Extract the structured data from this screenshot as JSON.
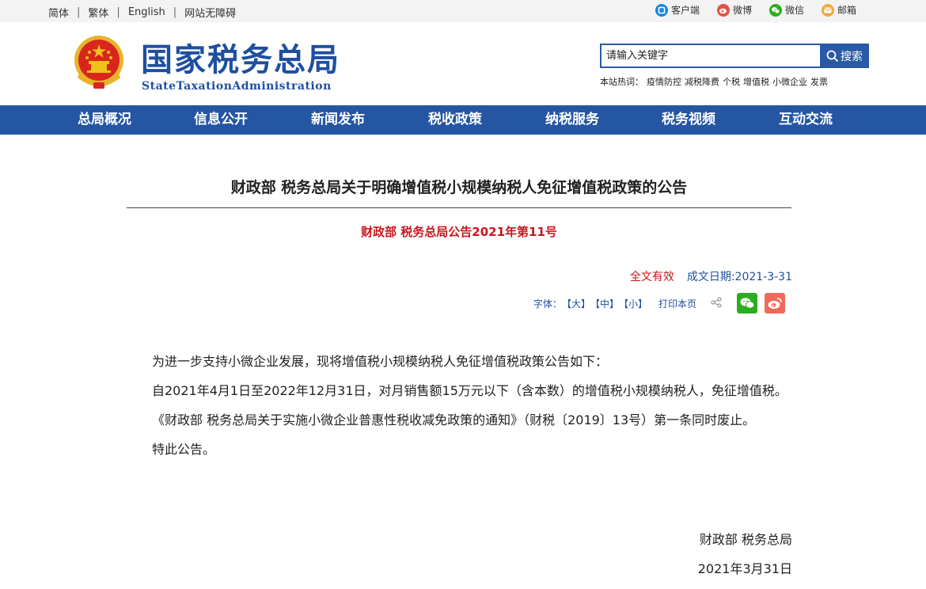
{
  "topbar": {
    "langs": [
      "简体",
      "繁体",
      "English",
      "网站无障碍"
    ],
    "socials": [
      {
        "label": "客户端",
        "icon": "client-icon",
        "color": "#1a86d8"
      },
      {
        "label": "微博",
        "icon": "weibo-icon",
        "color": "#e2533f"
      },
      {
        "label": "微信",
        "icon": "wechat-icon",
        "color": "#2aae1f"
      },
      {
        "label": "邮箱",
        "icon": "mail-icon",
        "color": "#f2a83c"
      }
    ]
  },
  "header": {
    "logo_cn": "国家税务总局",
    "logo_en": "StateTaxationAdministration",
    "search_placeholder": "请输入关键字",
    "search_button": "搜索",
    "hot_label": "本站热词：",
    "hot_words": [
      "疫情防控",
      "减税降费",
      "个税",
      "增值税",
      "小微企业",
      "发票"
    ]
  },
  "nav": [
    "总局概况",
    "信息公开",
    "新闻发布",
    "税收政策",
    "纳税服务",
    "税务视频",
    "互动交流"
  ],
  "article": {
    "title": "财政部 税务总局关于明确增值税小规模纳税人免征增值税政策的公告",
    "doc_number": "财政部 税务总局公告2021年第11号",
    "validity": "全文有效",
    "date_label": "成文日期:2021-3-31",
    "font_label": "字体：",
    "font_large": "【大】",
    "font_medium": "【中】",
    "font_small": "【小】",
    "print_label": "打印本页",
    "paragraphs": [
      "为进一步支持小微企业发展，现将增值税小规模纳税人免征增值税政策公告如下：",
      "自2021年4月1日至2022年12月31日，对月销售额15万元以下（含本数）的增值税小规模纳税人，免征增值税。",
      "《财政部 税务总局关于实施小微企业普惠性税收减免政策的通知》（财税〔2019〕13号）第一条同时废止。",
      "特此公告。"
    ],
    "signature": "财政部 税务总局",
    "sign_date": "2021年3月31日"
  },
  "colors": {
    "brand_blue": "#2456a4",
    "accent_red": "#c8161d"
  }
}
